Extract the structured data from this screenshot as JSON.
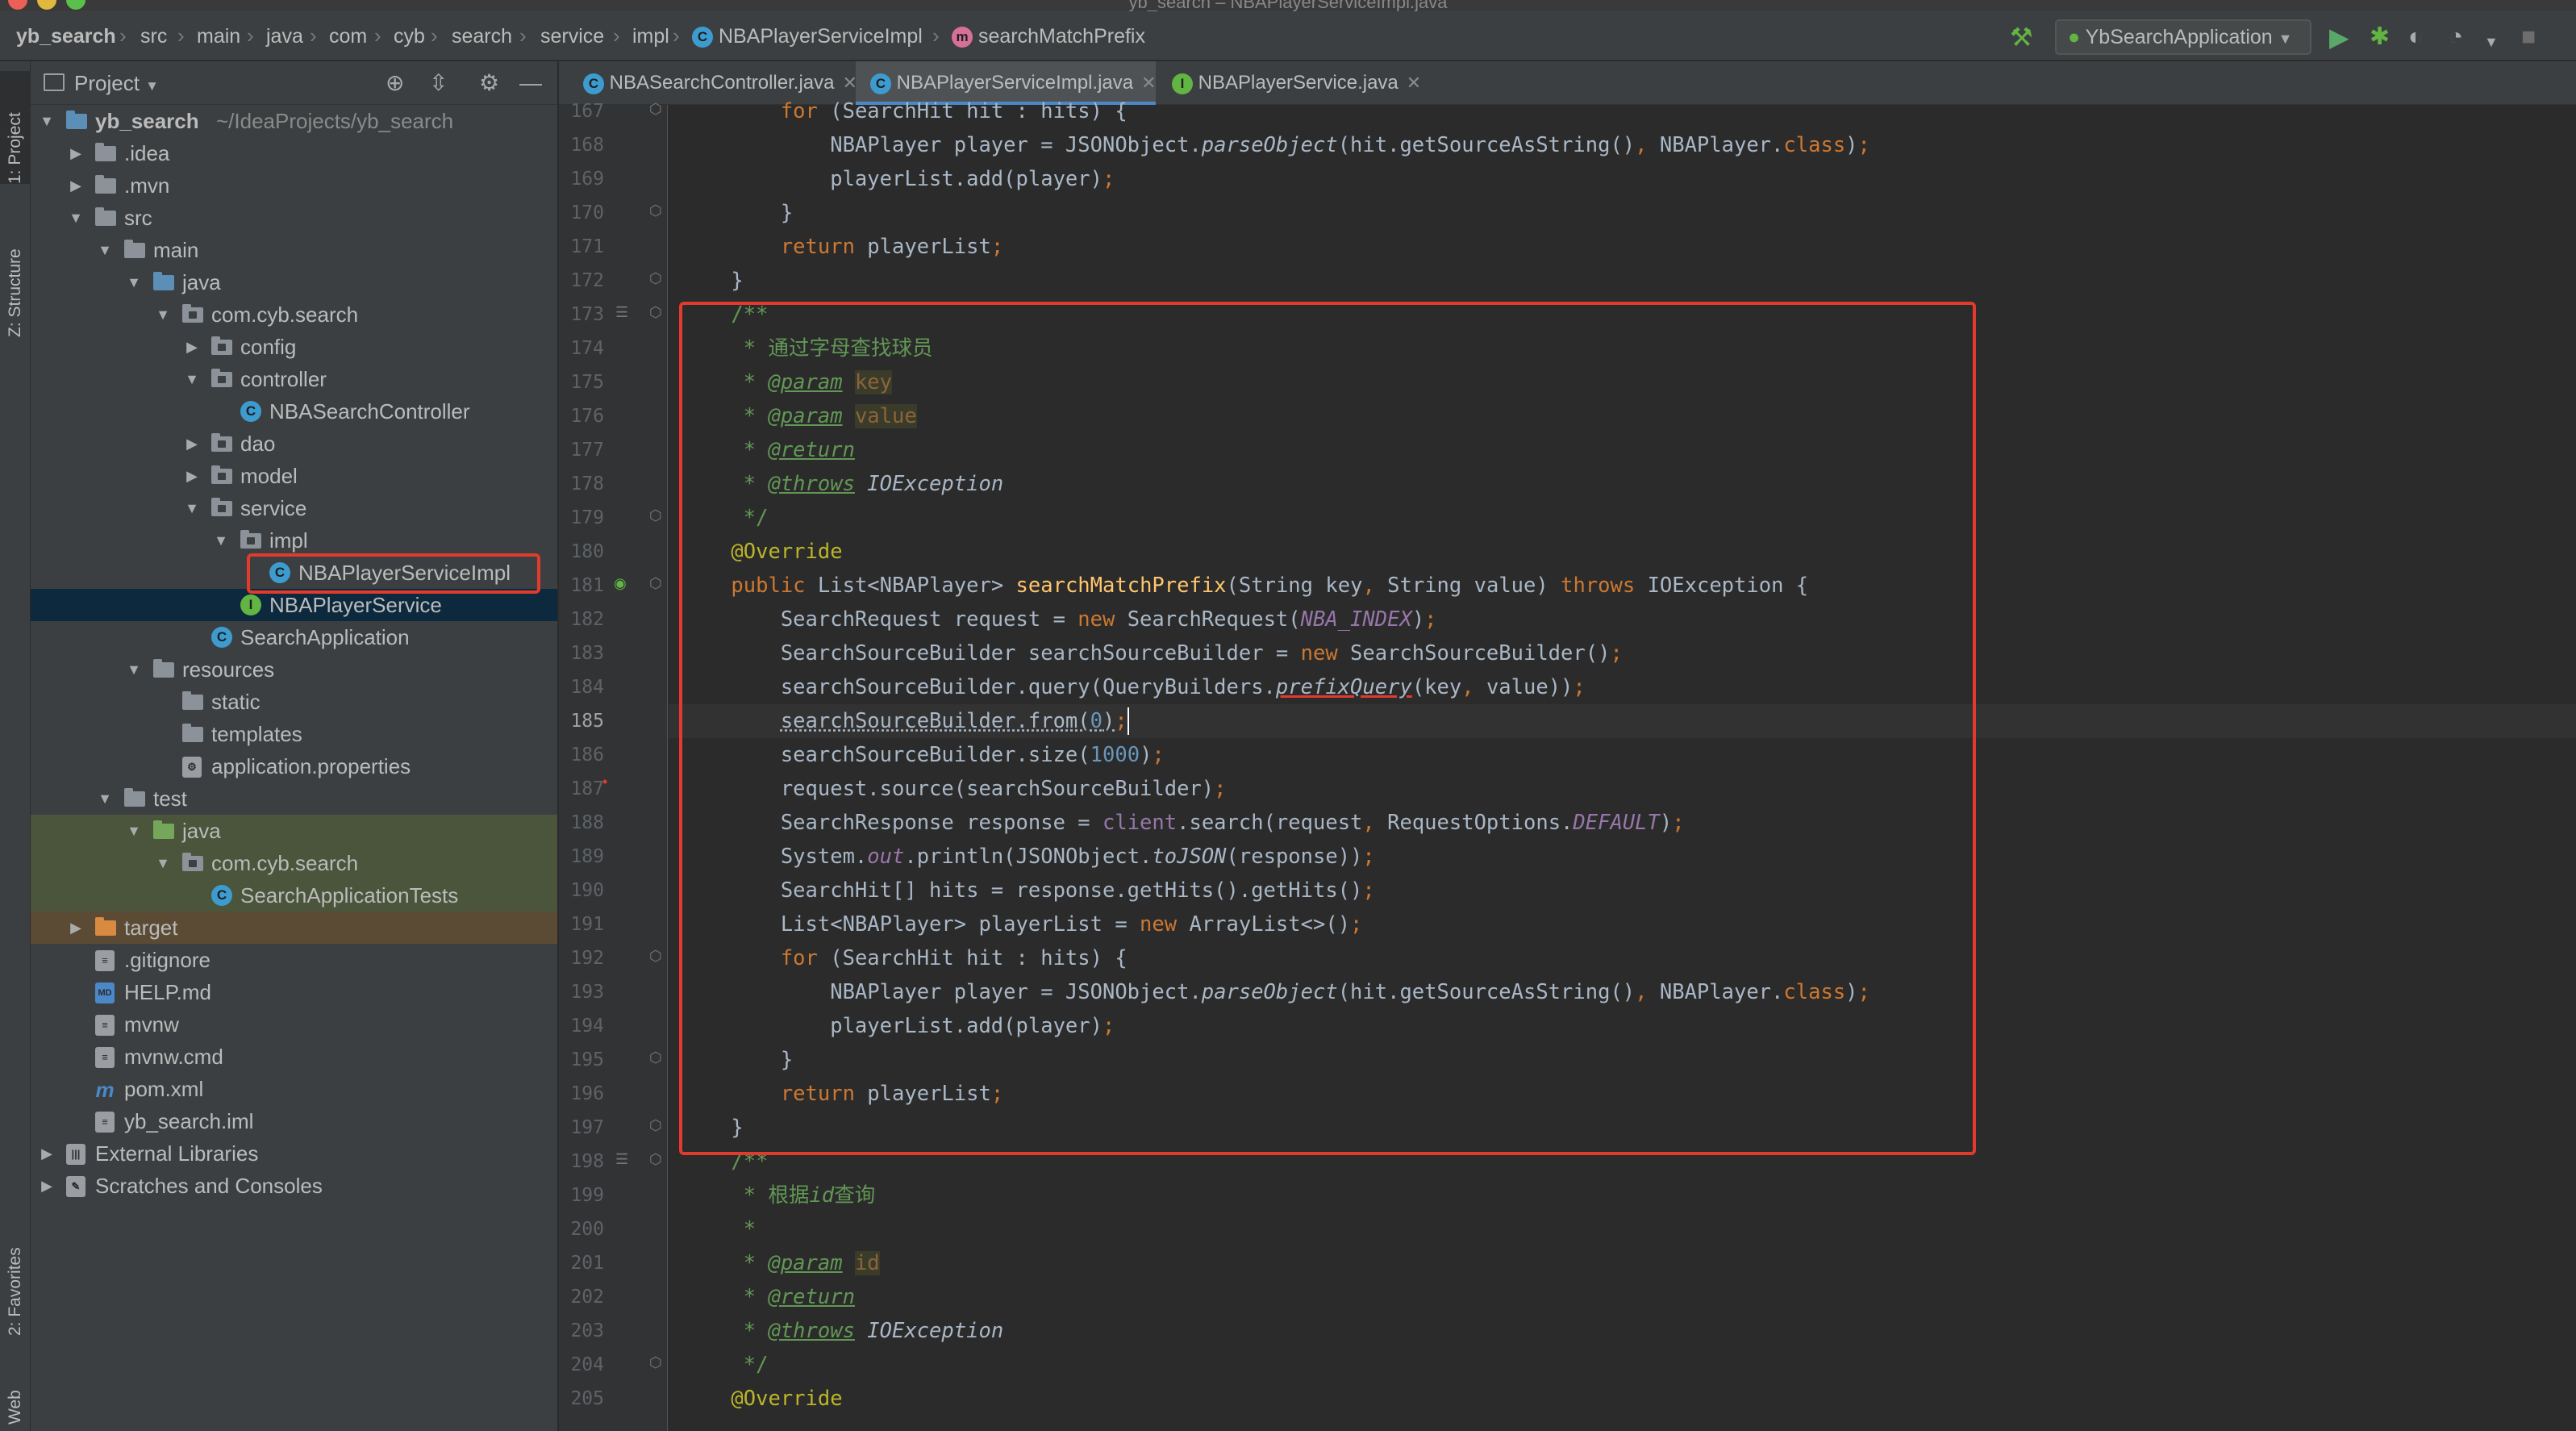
{
  "window": {
    "title": "yb_search – NBAPlayerServiceImpl.java"
  },
  "navbar": {
    "crumbs": [
      "yb_search",
      "src",
      "main",
      "java",
      "com",
      "cyb",
      "search",
      "service",
      "impl",
      "NBAPlayerServiceImpl",
      "searchMatchPrefix"
    ],
    "run_config": "YbSearchApplication"
  },
  "side_tabs": {
    "project": "1: Project",
    "structure": "Z: Structure",
    "favorites": "2: Favorites",
    "web": "Web"
  },
  "project_panel": {
    "title": "Project",
    "tree": [
      {
        "label": "yb_search",
        "suffix": "~/IdeaProjects/yb_search",
        "depth": 0,
        "arrow": "down",
        "icon": "folder-blue"
      },
      {
        "label": ".idea",
        "depth": 1,
        "arrow": "right",
        "icon": "folder"
      },
      {
        "label": ".mvn",
        "depth": 1,
        "arrow": "right",
        "icon": "folder"
      },
      {
        "label": "src",
        "depth": 1,
        "arrow": "down",
        "icon": "folder"
      },
      {
        "label": "main",
        "depth": 2,
        "arrow": "down",
        "icon": "folder"
      },
      {
        "label": "java",
        "depth": 3,
        "arrow": "down",
        "icon": "folder-blue"
      },
      {
        "label": "com.cyb.search",
        "depth": 4,
        "arrow": "down",
        "icon": "package"
      },
      {
        "label": "config",
        "depth": 5,
        "arrow": "right",
        "icon": "package"
      },
      {
        "label": "controller",
        "depth": 5,
        "arrow": "down",
        "icon": "package"
      },
      {
        "label": "NBASearchController",
        "depth": 6,
        "arrow": "",
        "icon": "class"
      },
      {
        "label": "dao",
        "depth": 5,
        "arrow": "right",
        "icon": "package"
      },
      {
        "label": "model",
        "depth": 5,
        "arrow": "right",
        "icon": "package"
      },
      {
        "label": "service",
        "depth": 5,
        "arrow": "down",
        "icon": "package"
      },
      {
        "label": "impl",
        "depth": 6,
        "arrow": "down",
        "icon": "package"
      },
      {
        "label": "NBAPlayerServiceImpl",
        "depth": 7,
        "arrow": "",
        "icon": "class"
      },
      {
        "label": "NBAPlayerService",
        "depth": 6,
        "arrow": "",
        "icon": "interface",
        "selected": true
      },
      {
        "label": "SearchApplication",
        "depth": 5,
        "arrow": "",
        "icon": "class-spring"
      },
      {
        "label": "resources",
        "depth": 3,
        "arrow": "down",
        "icon": "folder"
      },
      {
        "label": "static",
        "depth": 4,
        "arrow": "",
        "icon": "folder"
      },
      {
        "label": "templates",
        "depth": 4,
        "arrow": "",
        "icon": "folder"
      },
      {
        "label": "application.properties",
        "depth": 4,
        "arrow": "",
        "icon": "properties"
      },
      {
        "label": "test",
        "depth": 2,
        "arrow": "down",
        "icon": "folder"
      },
      {
        "label": "java",
        "depth": 3,
        "arrow": "down",
        "icon": "folder-green",
        "bg": "test"
      },
      {
        "label": "com.cyb.search",
        "depth": 4,
        "arrow": "down",
        "icon": "package",
        "bg": "test"
      },
      {
        "label": "SearchApplicationTests",
        "depth": 5,
        "arrow": "",
        "icon": "class-spring",
        "bg": "test"
      },
      {
        "label": "target",
        "depth": 1,
        "arrow": "right",
        "icon": "folder-orange",
        "bg": "target"
      },
      {
        "label": ".gitignore",
        "depth": 1,
        "arrow": "",
        "icon": "file"
      },
      {
        "label": "HELP.md",
        "depth": 1,
        "arrow": "",
        "icon": "md"
      },
      {
        "label": "mvnw",
        "depth": 1,
        "arrow": "",
        "icon": "file"
      },
      {
        "label": "mvnw.cmd",
        "depth": 1,
        "arrow": "",
        "icon": "file"
      },
      {
        "label": "pom.xml",
        "depth": 1,
        "arrow": "",
        "icon": "maven"
      },
      {
        "label": "yb_search.iml",
        "depth": 1,
        "arrow": "",
        "icon": "file"
      },
      {
        "label": "External Libraries",
        "depth": 0,
        "arrow": "right",
        "icon": "library"
      },
      {
        "label": "Scratches and Consoles",
        "depth": 0,
        "arrow": "right",
        "icon": "scratch"
      }
    ]
  },
  "editor": {
    "tabs": [
      {
        "label": "NBASearchController.java",
        "icon": "C",
        "active": false
      },
      {
        "label": "NBAPlayerServiceImpl.java",
        "icon": "C",
        "active": true
      },
      {
        "label": "NBAPlayerService.java",
        "icon": "I",
        "active": false
      }
    ],
    "current_line": 185,
    "lines": [
      {
        "n": 167,
        "code": "        <span class='kw'>for</span> (SearchHit hit : hits) {"
      },
      {
        "n": 168,
        "code": "            NBAPlayer player = JSONObject.<span class='it'>parseObject</span>(hit.getSourceAsString()<span class='kw'>,</span> NBAPlayer.<span class='kw'>class</span>)<span class='kw'>;</span>"
      },
      {
        "n": 169,
        "code": "            playerList.add(player)<span class='kw'>;</span>"
      },
      {
        "n": 170,
        "code": "        }"
      },
      {
        "n": 171,
        "code": "        <span class='kw'>return</span> playerList<span class='kw'>;</span>"
      },
      {
        "n": 172,
        "code": "    }"
      },
      {
        "n": 173,
        "code": "    <span class='cm'>/**</span>"
      },
      {
        "n": 174,
        "code": "<span class='cm'>     * 通过字母查找球员</span>"
      },
      {
        "n": 175,
        "code": "<span class='cm'>     * </span><span class='tag'>@param</span> <span class='pdim'>key</span>"
      },
      {
        "n": 176,
        "code": "<span class='cm'>     * </span><span class='tag'>@param</span> <span class='pdim'>value</span>"
      },
      {
        "n": 177,
        "code": "<span class='cm'>     * </span><span class='tag'>@return</span>"
      },
      {
        "n": 178,
        "code": "<span class='cm'>     * </span><span class='tag'>@throws</span> <span class='it'>IOException</span>"
      },
      {
        "n": 179,
        "code": "<span class='cm'>     */</span>"
      },
      {
        "n": 180,
        "code": "    <span class='an'>@Override</span>"
      },
      {
        "n": 181,
        "code": "    <span class='kw'>public</span> List&lt;NBAPlayer&gt; <span class='fn'>searchMatchPrefix</span>(String key<span class='kw'>,</span> String value) <span class='kw'>throws</span> IOException {"
      },
      {
        "n": 182,
        "code": "        SearchRequest request = <span class='kw'>new</span> SearchRequest(<span class='cst'>NBA_INDEX</span>)<span class='kw'>;</span>"
      },
      {
        "n": 183,
        "code": "        SearchSourceBuilder searchSourceBuilder = <span class='kw'>new</span> SearchSourceBuilder()<span class='kw'>;</span>"
      },
      {
        "n": 184,
        "code": "        searchSourceBuilder.query(QueryBuilders.<span class='it sq'>prefixQuery</span>(key<span class='kw'>,</span> value))<span class='kw'>;</span>"
      },
      {
        "n": 185,
        "code": "        <span class='dot'>searchSourceBuilder.from(<span class='num'>0</span>)</span><span class='kw'>;</span>"
      },
      {
        "n": 186,
        "code": "        searchSourceBuilder.size(<span class='num'>1000</span>)<span class='kw'>;</span>"
      },
      {
        "n": 187,
        "code": "        request.source(searchSourceBuilder)<span class='kw'>;</span>"
      },
      {
        "n": 188,
        "code": "        SearchResponse response = <span class='fld'>client</span>.search(request<span class='kw'>,</span> RequestOptions.<span class='cst'>DEFAULT</span>)<span class='kw'>;</span>"
      },
      {
        "n": 189,
        "code": "        System.<span class='cst'>out</span>.println(JSONObject.<span class='it'>toJSON</span>(response))<span class='kw'>;</span>"
      },
      {
        "n": 190,
        "code": "        SearchHit[] hits = response.getHits().getHits()<span class='kw'>;</span>"
      },
      {
        "n": 191,
        "code": "        List&lt;NBAPlayer&gt; playerList = <span class='kw'>new</span> ArrayList&lt;&gt;()<span class='kw'>;</span>"
      },
      {
        "n": 192,
        "code": "        <span class='kw'>for</span> (SearchHit hit : hits) {"
      },
      {
        "n": 193,
        "code": "            NBAPlayer player = JSONObject.<span class='it'>parseObject</span>(hit.getSourceAsString()<span class='kw'>,</span> NBAPlayer.<span class='kw'>class</span>)<span class='kw'>;</span>"
      },
      {
        "n": 194,
        "code": "            playerList.add(player)<span class='kw'>;</span>"
      },
      {
        "n": 195,
        "code": "        }"
      },
      {
        "n": 196,
        "code": "        <span class='kw'>return</span> playerList<span class='kw'>;</span>"
      },
      {
        "n": 197,
        "code": "    }"
      },
      {
        "n": 198,
        "code": "    <span class='cm'>/**</span>"
      },
      {
        "n": 199,
        "code": "<span class='cm'>     * 根据</span><span class='cm' style='font-style:italic'>id</span><span class='cm'>查询</span>"
      },
      {
        "n": 200,
        "code": "<span class='cm'>     *</span>"
      },
      {
        "n": 201,
        "code": "<span class='cm'>     * </span><span class='tag'>@param</span> <span class='pdim'>id</span>"
      },
      {
        "n": 202,
        "code": "<span class='cm'>     * </span><span class='tag'>@return</span>"
      },
      {
        "n": 203,
        "code": "<span class='cm'>     * </span><span class='tag'>@throws</span> <span class='it'>IOException</span>"
      },
      {
        "n": 204,
        "code": "<span class='cm'>     */</span>"
      },
      {
        "n": 205,
        "code": "    <span class='an'>@Override</span>"
      }
    ]
  },
  "colors": {
    "annotation_box": "#e23a2d",
    "selection": "#0d293e"
  }
}
